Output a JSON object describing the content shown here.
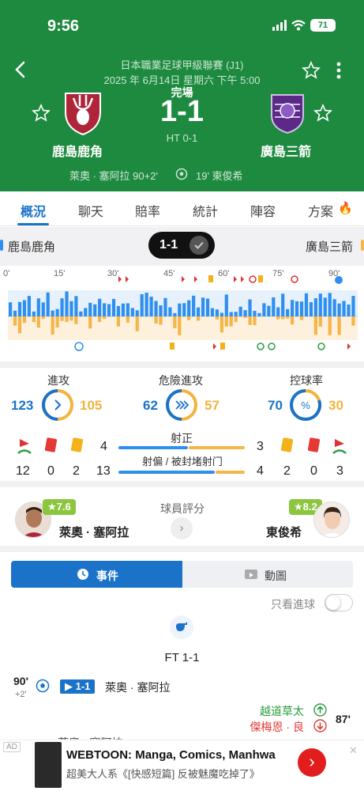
{
  "status": {
    "time": "9:56",
    "battery": "71"
  },
  "match": {
    "league": "日本職業足球甲級聯賽 (J1)",
    "datetime": "2025 年 6月14日 星期六 下午 5:00",
    "status": "完場",
    "score": "1-1",
    "halftime": "HT 0-1",
    "home_team": "鹿島鹿角",
    "away_team": "廣島三箭",
    "home_scorer": "萊奧 · 塞阿拉 90+2'",
    "away_scorer": "19' 東俊希"
  },
  "tabs": [
    {
      "label": "概況",
      "active": true
    },
    {
      "label": "聊天"
    },
    {
      "label": "賠率"
    },
    {
      "label": "統計"
    },
    {
      "label": "陣容"
    },
    {
      "label": "方案"
    }
  ],
  "timeline": {
    "home_team": "鹿島鹿角",
    "away_team": "廣島三箭",
    "score_pill": "1-1",
    "minutes": [
      "0'",
      "15'",
      "30'",
      "45'",
      "60'",
      "75'",
      "90'"
    ],
    "home_color": "#2f8ff0",
    "away_color": "#f7b548"
  },
  "stats": {
    "attack": {
      "label": "進攻",
      "home": "123",
      "away": "105"
    },
    "dangerous": {
      "label": "危險進攻",
      "home": "62",
      "away": "57"
    },
    "possession": {
      "label": "控球率",
      "home": "70",
      "away": "30"
    },
    "on_target": {
      "label": "射正",
      "home": "4",
      "away": "3"
    },
    "off_target": {
      "label": "射偏 / 被封堵射门",
      "home": "13",
      "away": "4"
    },
    "home_corners": "12",
    "home_red": "0",
    "home_yellow": "2",
    "away_yellow": "2",
    "away_red": "0",
    "away_corners": "3"
  },
  "rating": {
    "title": "球員評分",
    "home_player": "萊奧 · 塞阿拉",
    "home_rating": "★7.6",
    "away_player": "東俊希",
    "away_rating": "★8.2"
  },
  "events": {
    "tab_events": "事件",
    "tab_animation": "動圖",
    "only_goals": "只看進球",
    "ft": "FT 1-1",
    "goal_minute": "90'",
    "goal_extra": "+2'",
    "goal_score": "▶ 1-1",
    "goal_player": "萊奧 · 塞阿拉",
    "sub_in": "越道草太",
    "sub_out": "傑梅恩 · 良",
    "sub_minute": "87'",
    "next_player": "萊奧 · 塞阿拉"
  },
  "ad": {
    "badge": "AD",
    "title": "WEBTOON: Manga, Comics, Manhwa",
    "subtitle": "超美大人系《[快感短篇] 反被魅魔吃掉了》"
  }
}
